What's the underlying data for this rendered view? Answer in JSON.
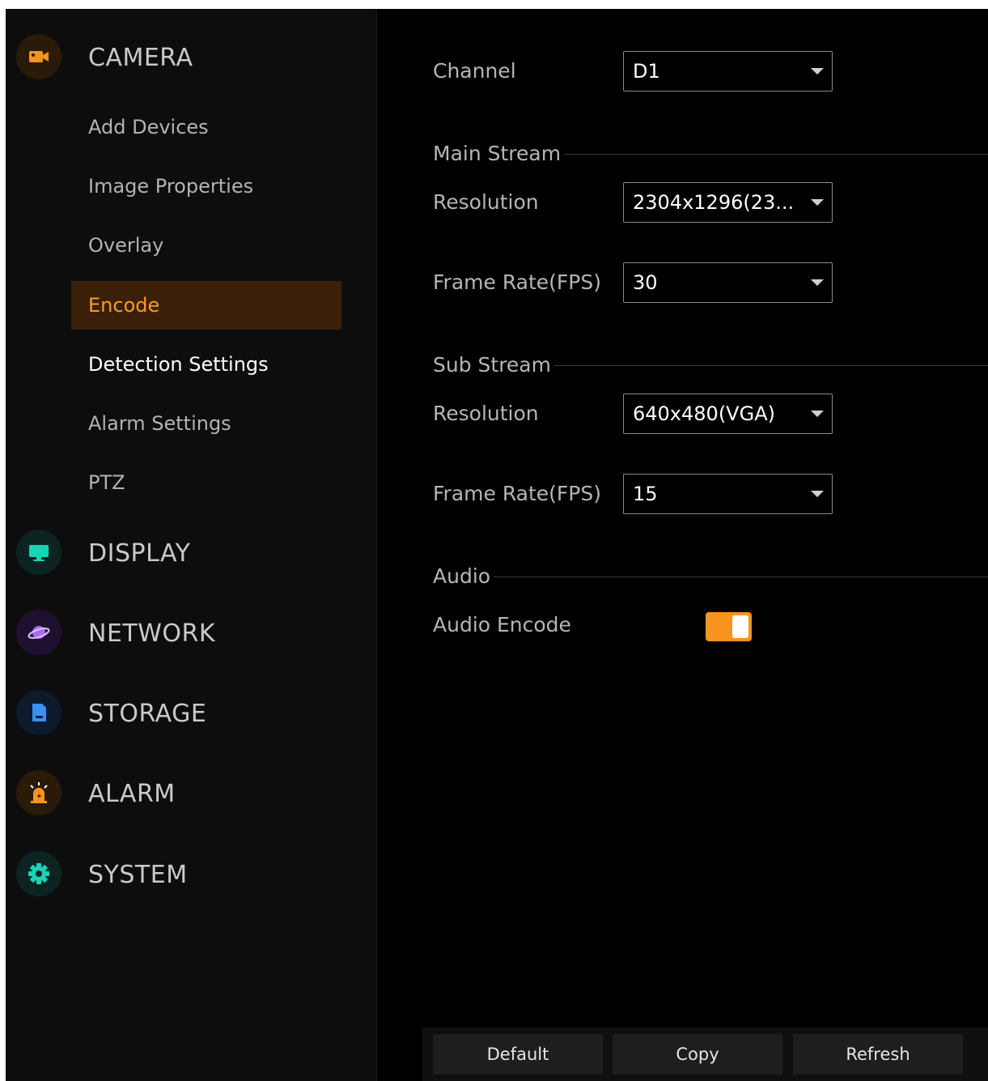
{
  "sidebar": {
    "categories": {
      "camera": {
        "label": "CAMERA",
        "icon": "camera-icon",
        "color": "#f7941d"
      },
      "display": {
        "label": "DISPLAY",
        "icon": "monitor-icon",
        "color": "#19d3b5"
      },
      "network": {
        "label": "NETWORK",
        "icon": "planet-icon",
        "color": "#a66bf2"
      },
      "storage": {
        "label": "STORAGE",
        "icon": "storage-icon",
        "color": "#3a8ff5"
      },
      "alarm": {
        "label": "ALARM",
        "icon": "alarm-light-icon",
        "color": "#f7941d"
      },
      "system": {
        "label": "SYSTEM",
        "icon": "gear-icon",
        "color": "#19d3b5"
      }
    },
    "camera_items": [
      {
        "label": "Add Devices"
      },
      {
        "label": "Image Properties"
      },
      {
        "label": "Overlay"
      },
      {
        "label": "Encode",
        "active": true
      },
      {
        "label": "Detection Settings"
      },
      {
        "label": "Alarm Settings"
      },
      {
        "label": "PTZ"
      }
    ]
  },
  "form": {
    "channel": {
      "label": "Channel",
      "value": "D1"
    },
    "main_stream": {
      "title": "Main Stream",
      "resolution": {
        "label": "Resolution",
        "value": "2304x1296(23..."
      },
      "frame_rate": {
        "label": "Frame Rate(FPS)",
        "value": "30"
      }
    },
    "sub_stream": {
      "title": "Sub Stream",
      "resolution": {
        "label": "Resolution",
        "value": "640x480(VGA)"
      },
      "frame_rate": {
        "label": "Frame Rate(FPS)",
        "value": "15"
      }
    },
    "audio": {
      "title": "Audio",
      "encode": {
        "label": "Audio Encode",
        "enabled": true
      }
    }
  },
  "footer": {
    "default_label": "Default",
    "copy_label": "Copy",
    "refresh_label": "Refresh"
  },
  "colors": {
    "accent": "#f7941d",
    "active_item_bg": "#3b2009"
  }
}
